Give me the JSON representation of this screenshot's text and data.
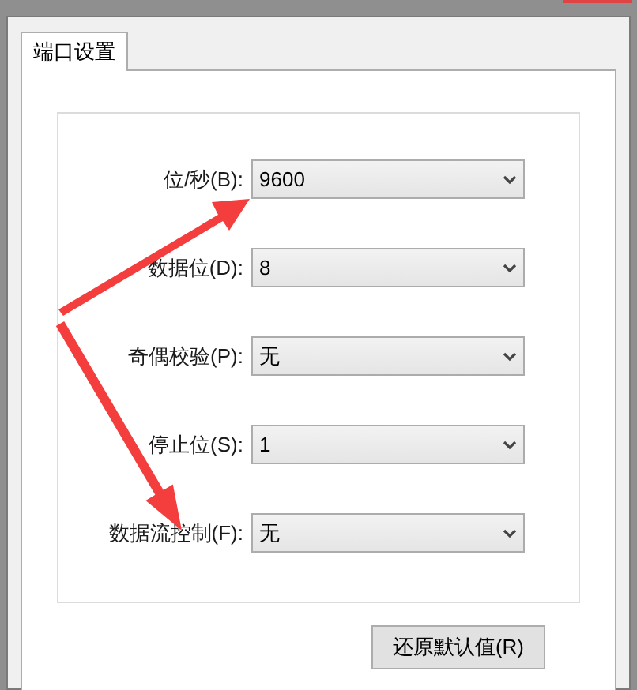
{
  "tabs": [
    {
      "label": "端口设置",
      "selected": true
    }
  ],
  "fields": [
    {
      "label": "位/秒(B):",
      "value": "9600"
    },
    {
      "label": "数据位(D):",
      "value": "8"
    },
    {
      "label": "奇偶校验(P):",
      "value": "无"
    },
    {
      "label": "停止位(S):",
      "value": "1"
    },
    {
      "label": "数据流控制(F):",
      "value": "无"
    }
  ],
  "buttons": [
    "还原默认值(R)"
  ]
}
